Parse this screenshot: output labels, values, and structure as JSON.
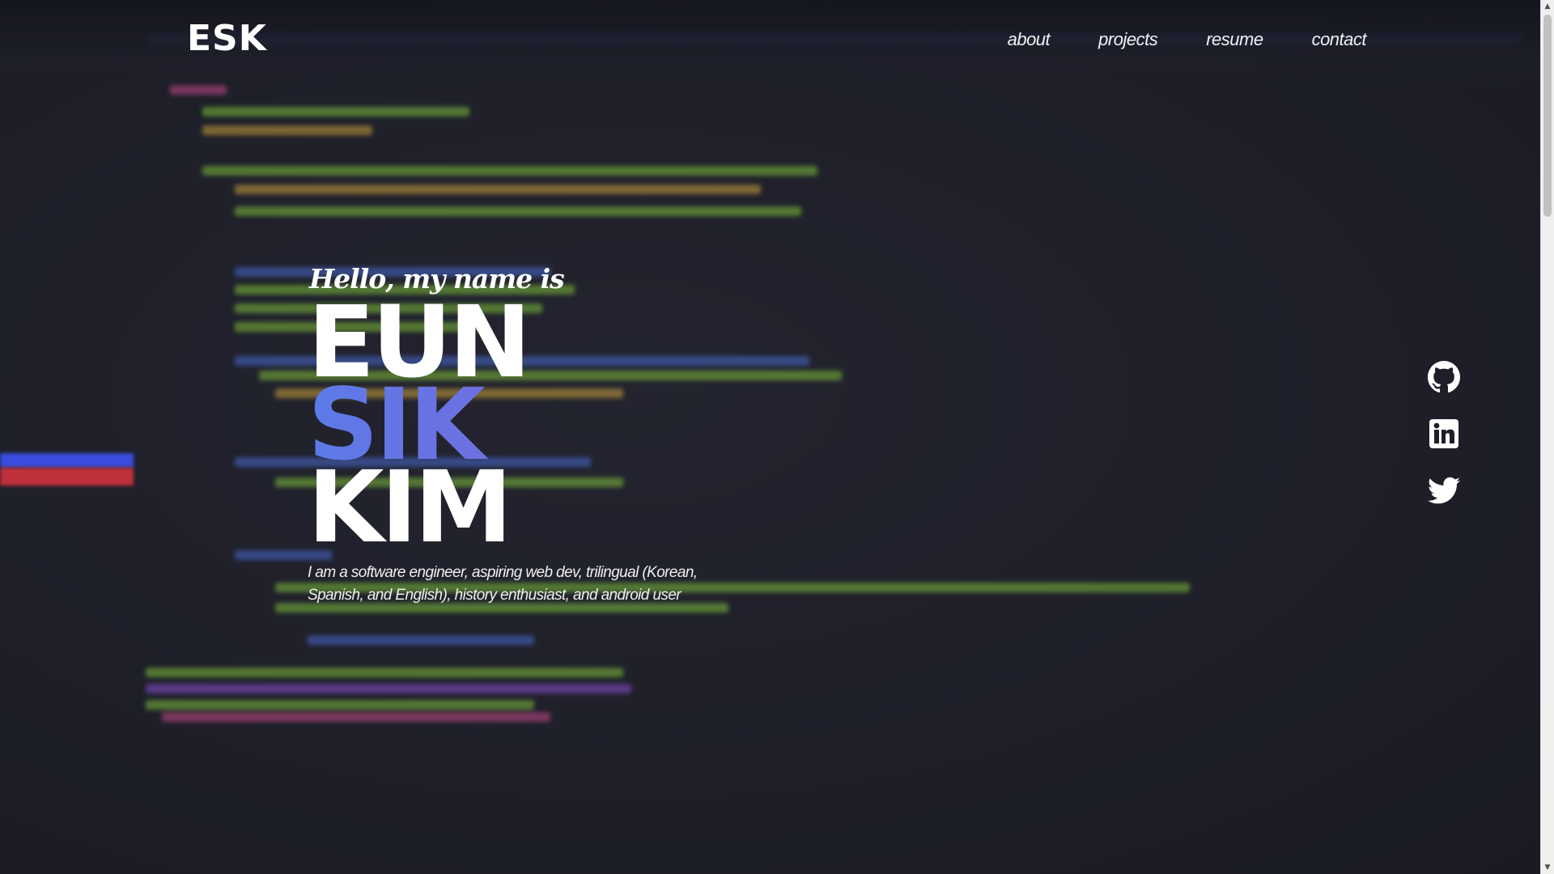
{
  "header": {
    "logo": "ESK",
    "nav": [
      "about",
      "projects",
      "resume",
      "contact"
    ]
  },
  "hero": {
    "greeting": "Hello, my name is",
    "name_lines": [
      "EUN",
      "SIK",
      "KIM"
    ],
    "tagline": "I am a software engineer, aspiring web dev, trilingual (Korean, Spanish, and English), history enthusiast, and android user"
  },
  "social": [
    {
      "name": "github-icon"
    },
    {
      "name": "linkedin-icon"
    },
    {
      "name": "twitter-icon"
    }
  ],
  "colors": {
    "background": "#1e1f29",
    "text": "#ffffff",
    "accent_start": "#5b7be8",
    "accent_end": "#8a5fd6"
  }
}
